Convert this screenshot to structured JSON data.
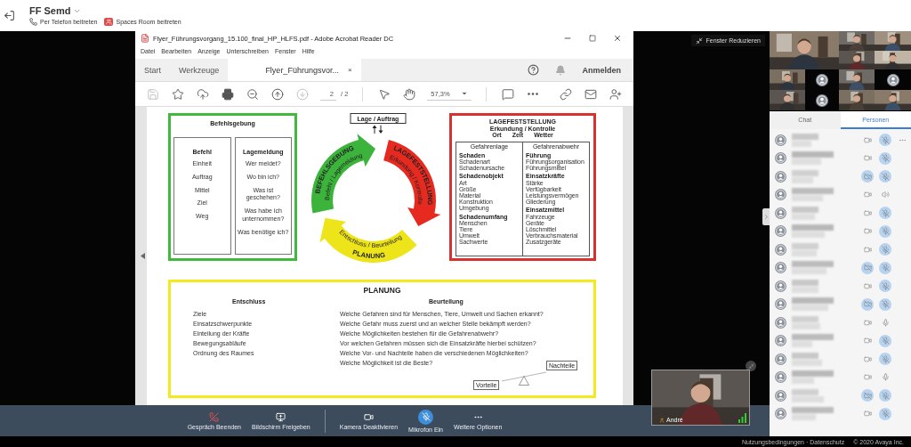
{
  "meeting": {
    "title": "FF Semd",
    "actions": [
      {
        "kind": "phone",
        "label": "Per Telefon beitreten"
      },
      {
        "kind": "room",
        "label": "Spaces Room beitreten"
      }
    ],
    "window_button": "Fenster Reduzieren",
    "self_view": {
      "name": "André"
    }
  },
  "acrobat": {
    "title": "Flyer_Führungsvorgang_15.100_final_HP_HLFS.pdf - Adobe Acrobat Reader DC",
    "menu": [
      "Datei",
      "Bearbeiten",
      "Anzeige",
      "Unterschreiben",
      "Fenster",
      "Hilfe"
    ],
    "tabs": [
      {
        "label": "Start",
        "selected": false
      },
      {
        "label": "Werkzeuge",
        "selected": false
      },
      {
        "label": "Flyer_Führungsvor...",
        "selected": true,
        "close": "×"
      }
    ],
    "sign_in": "Anmelden",
    "toolbar_left": [
      {
        "kind": "save",
        "disabled": true
      },
      {
        "kind": "star",
        "disabled": false
      },
      {
        "kind": "upload",
        "disabled": false
      },
      {
        "kind": "print",
        "disabled": false
      },
      {
        "kind": "zoom-out",
        "disabled": false
      },
      {
        "kind": "prev",
        "disabled": false
      },
      {
        "kind": "next",
        "disabled": true
      }
    ],
    "page_current": "2",
    "page_total": "/ 2",
    "toolbar_mid": [
      {
        "kind": "pointer",
        "disabled": false
      },
      {
        "kind": "hand",
        "disabled": false
      }
    ],
    "zoom": "57,3%",
    "toolbar_right": [
      {
        "kind": "comment",
        "disabled": false
      },
      {
        "kind": "more",
        "disabled": false
      }
    ],
    "toolbar_end": [
      {
        "kind": "link",
        "disabled": false
      },
      {
        "kind": "mail",
        "disabled": false
      },
      {
        "kind": "user",
        "disabled": false
      }
    ]
  },
  "document": {
    "command": {
      "title": "Befehlsgebung",
      "columns": [
        {
          "heading": "Befehl",
          "items": [
            "Einheit",
            "Auftrag",
            "Mittel",
            "Ziel",
            "Weg"
          ]
        },
        {
          "heading": "Lagemeldung",
          "items": [
            "Wer meldet?",
            "Wo bin ich?",
            "Was ist geschehen?",
            "Was habe ich unternommen?",
            "Was benötige ich?"
          ]
        }
      ]
    },
    "cycle": {
      "top": "Lage / Auftrag",
      "segments": [
        {
          "title": "BEFEHLSGEBUNG",
          "subtitle": "Befehl / Lagemeldung",
          "color": "#3cb43c"
        },
        {
          "title": "LAGEFESTSTELLUNG",
          "subtitle": "Erkundung / Kontrolle",
          "color": "#e62a20"
        },
        {
          "title": "PLANUNG",
          "subtitle": "Entschluss / Beurteilung",
          "color": "#eee41a"
        }
      ]
    },
    "assessment": {
      "title": "LAGEFESTSTELLUNG",
      "subtitle": "Erkundung / Kontrolle",
      "factors": [
        "Ort",
        "Zeit",
        "Wetter"
      ],
      "columns": [
        {
          "heading": "Gefahrenlage",
          "groups": [
            {
              "heading": "Schaden",
              "items": [
                "Schadenart",
                "Schadenursache"
              ]
            },
            {
              "heading": "Schadenobjekt",
              "items": [
                "Art",
                "Größe",
                "Material",
                "Konstruktion",
                "Umgebung"
              ]
            },
            {
              "heading": "Schadenumfang",
              "items": [
                "Menschen",
                "Tiere",
                "Umwelt",
                "Sachwerte"
              ]
            }
          ]
        },
        {
          "heading": "Gefahrenabwehr",
          "groups": [
            {
              "heading": "Führung",
              "items": [
                "Führungsorganisation",
                "Führungsmittel"
              ]
            },
            {
              "heading": "Einsatzkräfte",
              "items": [
                "Stärke",
                "Verfügbarkeit",
                "Leistungsvermögen",
                "Gliederung"
              ]
            },
            {
              "heading": "Einsatzmittel",
              "items": [
                "Fahrzeuge",
                "Geräte",
                "Löschmittel",
                "Verbrauchsmaterial",
                "Zusatzgeräte"
              ]
            }
          ]
        }
      ]
    },
    "planning": {
      "title": "PLANUNG",
      "left_heading": "Entschluss",
      "right_heading": "Beurteilung",
      "left_items": [
        "Ziele",
        "Einsatzschwerpunkte",
        "Einteilung der Kräfte",
        "Bewegungsabläufe",
        "Ordnung des Raumes"
      ],
      "right_items": [
        "Welche Gefahren sind für Menschen, Tiere, Umwelt und Sachen erkannt?",
        "Welche Gefahr muss zuerst und an welcher Stelle bekämpft werden?",
        "Welche Möglichkeiten bestehen für die Gefahrenabwehr?",
        "Vor welchen Gefahren müssen sich die Einsatzkräfte hierbei schützen?",
        "Welche Vor- und Nachteile haben die verschiedenen Möglichkeiten?",
        "Welche Möglichkeit ist die Beste?"
      ],
      "scale": [
        "Vorteile",
        "Nachteile"
      ]
    }
  },
  "controls": [
    {
      "kind": "hangup",
      "label": "Gespräch Beenden",
      "highlighted": false
    },
    {
      "kind": "share",
      "label": "Bildschirm Freigeben",
      "highlighted": false
    },
    {
      "kind": "camera",
      "label": "Kamera Deaktivieren",
      "highlighted": false
    },
    {
      "kind": "mic",
      "label": "Mikrofon Ein",
      "highlighted": true
    },
    {
      "kind": "more",
      "label": "Weitere Optionen",
      "highlighted": false
    }
  ],
  "video_tiles": [
    {
      "kind": "picture"
    },
    {
      "kind": "picture"
    },
    {
      "kind": "picture"
    },
    {
      "kind": "picture"
    },
    {
      "kind": "picture"
    },
    {
      "kind": "picture"
    },
    {
      "kind": "avatar"
    },
    {
      "kind": "picture"
    },
    {
      "kind": "avatar"
    },
    {
      "kind": "picture"
    },
    {
      "kind": "avatar"
    },
    {
      "kind": "picture"
    },
    {
      "kind": "picture"
    }
  ],
  "panel_tabs": [
    {
      "label": "Chat",
      "selected": false
    },
    {
      "label": "Personen",
      "selected": true
    }
  ],
  "participants": [
    {
      "camera_on": true,
      "muted": true,
      "speaking": false,
      "more": true
    },
    {
      "camera_on": true,
      "muted": true,
      "speaking": false,
      "more": false
    },
    {
      "camera_on": false,
      "muted": true,
      "speaking": false,
      "more": false
    },
    {
      "camera_on": true,
      "muted": false,
      "speaking": true,
      "more": false
    },
    {
      "camera_on": true,
      "muted": true,
      "speaking": false,
      "more": false
    },
    {
      "camera_on": true,
      "muted": true,
      "speaking": false,
      "more": false
    },
    {
      "camera_on": true,
      "muted": true,
      "speaking": false,
      "more": false
    },
    {
      "camera_on": false,
      "muted": true,
      "speaking": false,
      "more": false
    },
    {
      "camera_on": true,
      "muted": true,
      "speaking": false,
      "more": false
    },
    {
      "camera_on": false,
      "muted": true,
      "speaking": false,
      "more": false
    },
    {
      "camera_on": true,
      "muted": false,
      "speaking": false,
      "more": false
    },
    {
      "camera_on": true,
      "muted": true,
      "speaking": false,
      "more": false
    },
    {
      "camera_on": true,
      "muted": true,
      "speaking": false,
      "more": false
    },
    {
      "camera_on": true,
      "muted": false,
      "speaking": false,
      "more": false
    },
    {
      "camera_on": false,
      "muted": true,
      "speaking": false,
      "more": false
    },
    {
      "camera_on": true,
      "muted": true,
      "speaking": false,
      "more": false
    }
  ],
  "footer": {
    "links": [
      "Nutzungsbedingungen",
      "Datenschutz"
    ],
    "separator": "·",
    "copyright": "© 2020 Avaya Inc."
  }
}
